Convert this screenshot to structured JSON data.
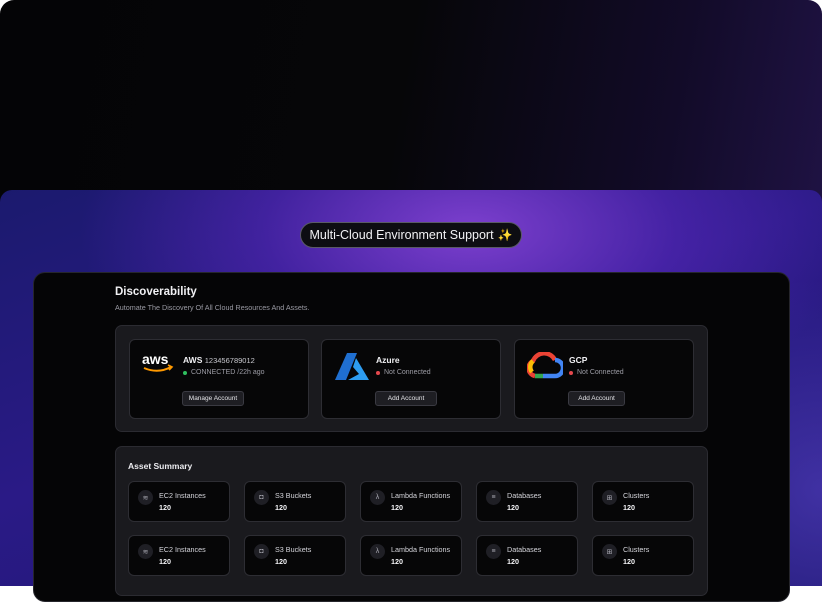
{
  "badge": {
    "label": "Multi-Cloud Environment Support",
    "sparkle": "✨"
  },
  "discoverability": {
    "title": "Discoverability",
    "subtitle": "Automate The Discovery Of All Cloud Resources And Assets."
  },
  "clouds": [
    {
      "name": "AWS",
      "account": "123456789012",
      "status": "CONNECTED /22h ago",
      "status_color": "#2fbf5f",
      "button": "Manage Account",
      "logo": "aws-logo"
    },
    {
      "name": "Azure",
      "account": "",
      "status": "Not Connected",
      "status_color": "#e5484d",
      "button": "Add Account",
      "logo": "azure-logo"
    },
    {
      "name": "GCP",
      "account": "",
      "status": "Not Connected",
      "status_color": "#e5484d",
      "button": "Add Account",
      "logo": "gcp-logo"
    }
  ],
  "asset_summary": {
    "title": "Asset Summary",
    "rows": [
      [
        {
          "label": "EC2 Instances",
          "count": "120",
          "icon": "layers-icon"
        },
        {
          "label": "S3 Buckets",
          "count": "120",
          "icon": "bucket-icon"
        },
        {
          "label": "Lambda Functions",
          "count": "120",
          "icon": "lambda-icon"
        },
        {
          "label": "Databases",
          "count": "120",
          "icon": "database-icon"
        },
        {
          "label": "Clusters",
          "count": "120",
          "icon": "cluster-icon"
        }
      ],
      [
        {
          "label": "EC2 Instances",
          "count": "120",
          "icon": "layers-icon"
        },
        {
          "label": "S3 Buckets",
          "count": "120",
          "icon": "bucket-icon"
        },
        {
          "label": "Lambda Functions",
          "count": "120",
          "icon": "lambda-icon"
        },
        {
          "label": "Databases",
          "count": "120",
          "icon": "database-icon"
        },
        {
          "label": "Clusters",
          "count": "120",
          "icon": "cluster-icon"
        }
      ]
    ]
  },
  "colors": {
    "accent_purple": "#5b2fc4",
    "panel_bg": "#050506",
    "card_bg": "#060607"
  }
}
